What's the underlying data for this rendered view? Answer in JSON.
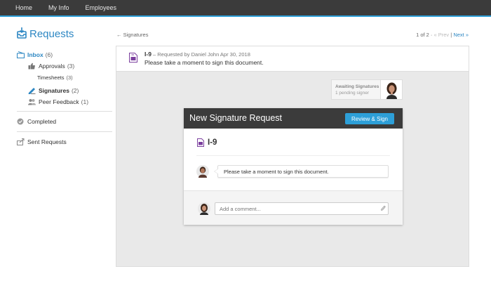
{
  "nav": {
    "items": [
      "Home",
      "My Info",
      "Employees"
    ]
  },
  "header": {
    "title": "Requests",
    "back_link": "← Signatures",
    "pager": {
      "position": "1 of 2",
      "sep1": " · ",
      "prev": "« Prev",
      "sep2": " | ",
      "next": "Next »"
    }
  },
  "sidebar": {
    "inbox": {
      "label": "Inbox",
      "count": "(6)"
    },
    "approvals": {
      "label": "Approvals",
      "count": "(3)"
    },
    "timesheets": {
      "label": "Timesheets",
      "count": "(3)"
    },
    "signatures": {
      "label": "Signatures",
      "count": "(2)"
    },
    "peer_feedback": {
      "label": "Peer Feedback",
      "count": "(1)"
    },
    "completed": {
      "label": "Completed"
    },
    "sent": {
      "label": "Sent Requests"
    }
  },
  "request": {
    "doc_name": "I-9",
    "dash": " – ",
    "requested_by": "Requested by Daniel John Apr 30, 2018",
    "message": "Please take a moment to sign this document."
  },
  "awaiting": {
    "title": "Awaiting Signatures",
    "subtitle": "1 pending signer"
  },
  "card": {
    "title": "New Signature Request",
    "button": "Review & Sign",
    "doc_name": "I-9",
    "message": "Please take a moment to sign this document.",
    "comment_placeholder": "Add a comment..."
  },
  "colors": {
    "accent": "#2d9fd8",
    "link": "#2d87c3",
    "topbar": "#3b3b3b",
    "doc_icon": "#7b3f9e"
  },
  "icons": [
    "inbox-tray-icon",
    "thumbs-up-icon",
    "pen-signature-icon",
    "people-icon",
    "check-circle-icon",
    "send-arrow-icon",
    "document-icon",
    "paperclip-icon"
  ]
}
